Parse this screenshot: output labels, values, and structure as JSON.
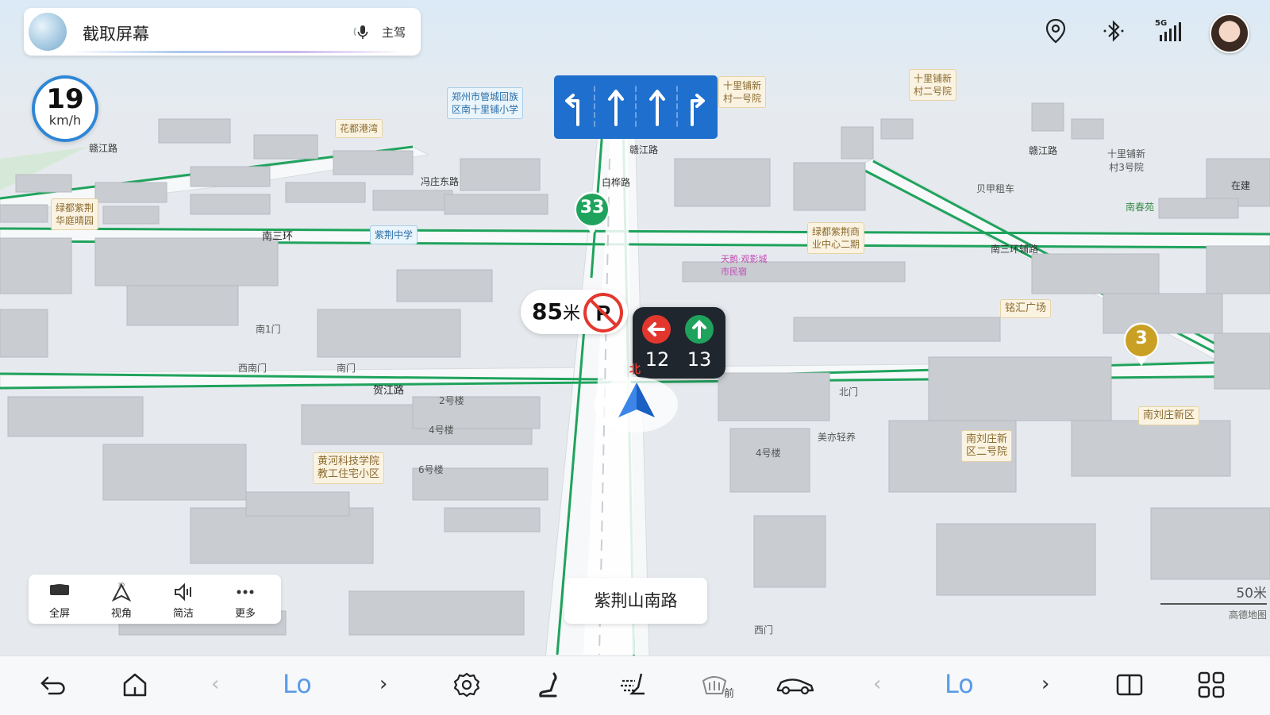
{
  "voice": {
    "title": "截取屏幕",
    "driver": "主驾"
  },
  "status_icons": [
    "location-icon",
    "bluetooth-icon",
    "signal-5g-icon",
    "avatar"
  ],
  "status": {
    "network": "5G"
  },
  "speed": {
    "value": "19",
    "unit": "km/h"
  },
  "lanes": [
    "turn-left",
    "straight",
    "straight",
    "turn-right"
  ],
  "distance": {
    "value": "85",
    "unit": "米"
  },
  "traffic_light": {
    "left_seconds": "12",
    "straight_seconds": "13",
    "north": "北"
  },
  "badges": {
    "route_33": "33",
    "route_3": "3"
  },
  "labels": {
    "zhengzhou_school": "郑州市管城回族\n区南十里铺小学",
    "shilipu_1": "十里铺新\n村一号院",
    "shilipu_2": "十里铺新\n村二号院",
    "huadu": "花都港湾",
    "ganjiang_road_left": "赣江路",
    "ganjiang_road_mid": "赣江路",
    "ganjiang_road_right": "赣江路",
    "shilipu_3": "十里铺新\n村3号院",
    "bailinglu": "白桦路",
    "pingfeng_road": "冯庄东路",
    "lvdu_zijing": "绿都紫荆\n华庭晴园",
    "nansanhuan": "南三环",
    "zijing_middle": "紫荆中学",
    "nansanhuan_fulu": "南三环辅路",
    "lvdu_shangye": "绿都紫荆商\n业中心二期",
    "nanchunyuan": "南春苑",
    "zaijian": "在建",
    "minghui": "铭汇广场",
    "nanliuzhuang": "南刘庄新区",
    "nanliuzhuang2": "南刘庄新\n区二号院",
    "huanghe_college": "黄河科技学院\n教工住宅小区",
    "hejiang_road": "贺江路",
    "south_gate_1": "南1门",
    "southwest_gate": "西南门",
    "south_gate": "南门",
    "north_gate": "北门",
    "meiyi": "美亦轻养",
    "west_gate": "西门",
    "building_2": "2号楼",
    "building_4": "4号楼",
    "building_6": "6号楼",
    "building_4b": "4号楼",
    "beijia": "贝甲租车",
    "tianyou": "天鹅·观影城\n市民宿"
  },
  "controls": [
    {
      "label": "全屏",
      "icon": "fullscreen-icon"
    },
    {
      "label": "视角",
      "icon": "3d-view-icon"
    },
    {
      "label": "简洁",
      "icon": "speaker-icon"
    },
    {
      "label": "更多",
      "icon": "more-icon"
    }
  ],
  "road_name": "紫荆山南路",
  "scale": {
    "value": "50米",
    "brand": "高德地图"
  },
  "dock": {
    "left_temp": "Lo",
    "right_temp": "Lo",
    "icons": [
      "back-icon",
      "home-icon",
      "settings-icon",
      "seat-heat-icon",
      "seat-vent-icon",
      "front-defrost-icon",
      "car-icon",
      "split-screen-icon",
      "apps-grid-icon"
    ],
    "defrost_label": "前"
  },
  "colors": {
    "accent": "#2f86d6",
    "lane_panel": "#1f6fce",
    "route_green": "#1fa35c",
    "temp": "#5b9be8"
  }
}
